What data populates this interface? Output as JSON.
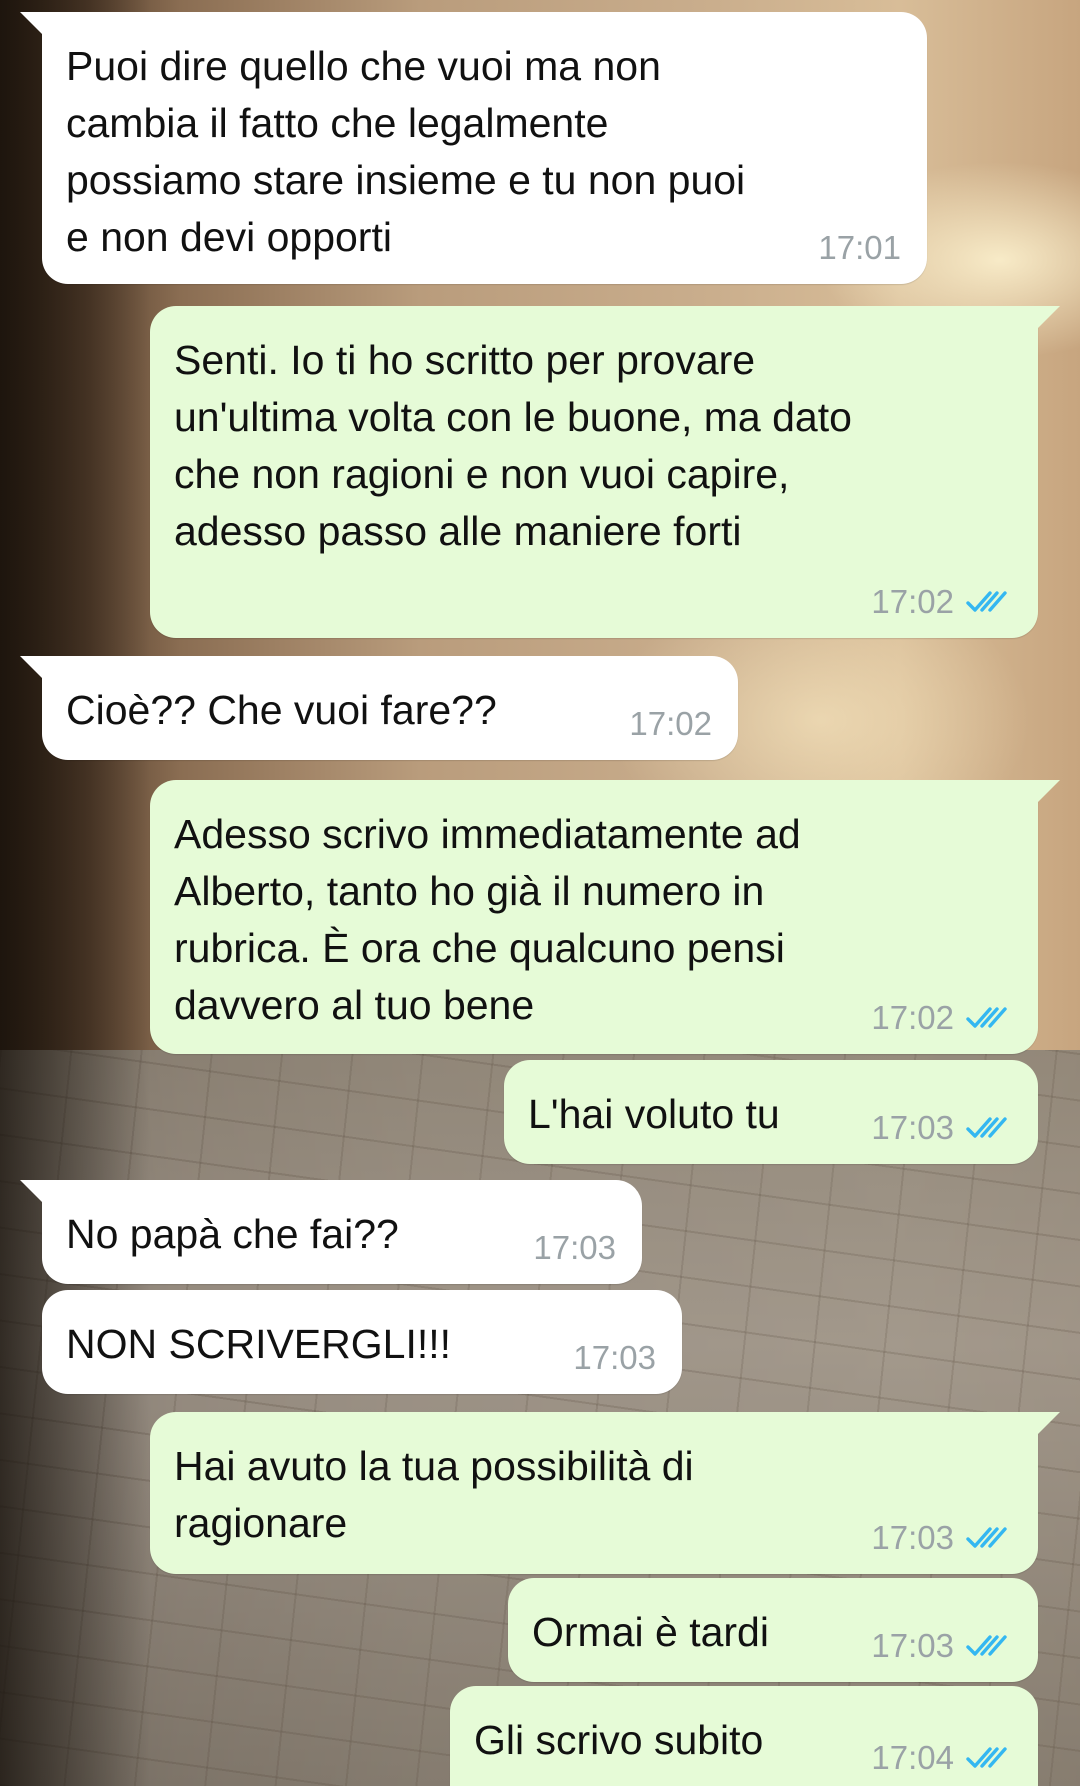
{
  "messages": [
    {
      "direction": "incoming",
      "text": "Puoi dire quello che vuoi ma non\ncambia il fatto che legalmente\npossiamo stare insieme e tu non puoi\ne non devi opporti",
      "time": "17:01"
    },
    {
      "direction": "outgoing",
      "text": "Senti. Io ti ho scritto per provare\nun'ultima volta con le buone, ma dato\nche non ragioni e non vuoi capire,\nadesso passo alle maniere forti",
      "time": "17:02",
      "read": true
    },
    {
      "direction": "incoming",
      "text": "Cioè?? Che vuoi fare??",
      "time": "17:02"
    },
    {
      "direction": "outgoing",
      "text": "Adesso scrivo immediatamente ad\nAlberto, tanto ho già il numero in\nrubrica. È ora che qualcuno pensi\ndavvero al tuo bene",
      "time": "17:02",
      "read": true
    },
    {
      "direction": "outgoing",
      "text": "L'hai voluto tu",
      "time": "17:03",
      "read": true
    },
    {
      "direction": "incoming",
      "text": "No papà che fai??",
      "time": "17:03"
    },
    {
      "direction": "incoming",
      "text": "NON SCRIVERGLI!!!",
      "time": "17:03"
    },
    {
      "direction": "outgoing",
      "text": "Hai avuto la tua possibilità di\nragionare",
      "time": "17:03",
      "read": true
    },
    {
      "direction": "outgoing",
      "text": "Ormai è tardi",
      "time": "17:03",
      "read": true
    },
    {
      "direction": "outgoing",
      "text": "Gli scrivo subito",
      "time": "17:04",
      "read": true
    }
  ],
  "icons": {
    "read_receipt": "double-check-icon"
  },
  "colors": {
    "incoming_bubble": "#ffffff",
    "outgoing_bubble": "#e6fbd7",
    "timestamp": "#9aa2a6",
    "read_tick": "#34b7f1"
  }
}
